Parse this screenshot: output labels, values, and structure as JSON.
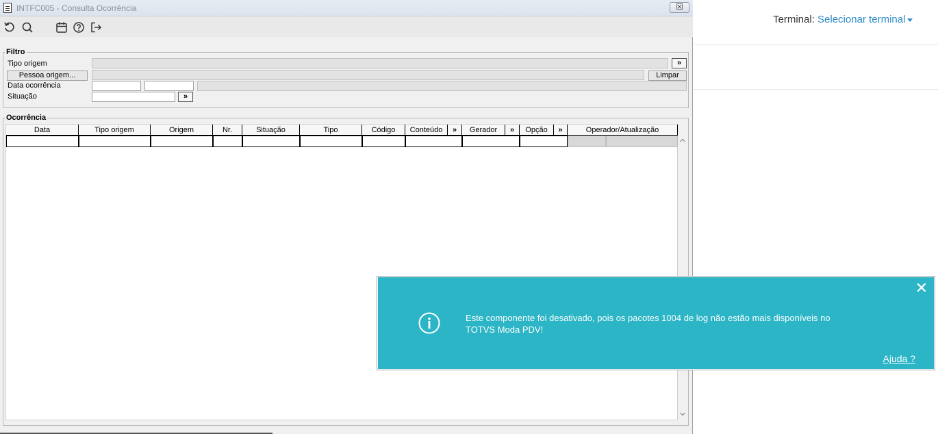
{
  "window": {
    "title": "INTFC005 - Consulta Ocorrência",
    "close_label": "☒"
  },
  "toolbar": {
    "icons": [
      "undo-icon",
      "search-icon",
      "calendar-icon",
      "help-icon",
      "exit-icon"
    ]
  },
  "filtro": {
    "legend": "Filtro",
    "tipo_origem_label": "Tipo origem",
    "pessoa_origem_button": "Pessoa origem...",
    "data_ocorrencia_label": "Data ocorrência",
    "situacao_label": "Situação",
    "more_button": "»",
    "limpar_button": "Limpar"
  },
  "ocorrencia": {
    "legend": "Ocorrência",
    "columns": [
      "Data",
      "Tipo origem",
      "Origem",
      "Nr.",
      "Situação",
      "Tipo",
      "Código",
      "Conteúdo",
      "»",
      "Gerador",
      "»",
      "Opção",
      "»",
      "Operador/Atualização"
    ]
  },
  "header_right": {
    "terminal_label": "Terminal:",
    "terminal_link": "Selecionar terminal"
  },
  "notice": {
    "message": "Este componente foi desativado, pois os pacotes 1004 de log não estão mais disponíveis no TOTVS Moda PDV!",
    "help_link": "Ajuda ?",
    "bg_color": "#2bb5c6"
  }
}
